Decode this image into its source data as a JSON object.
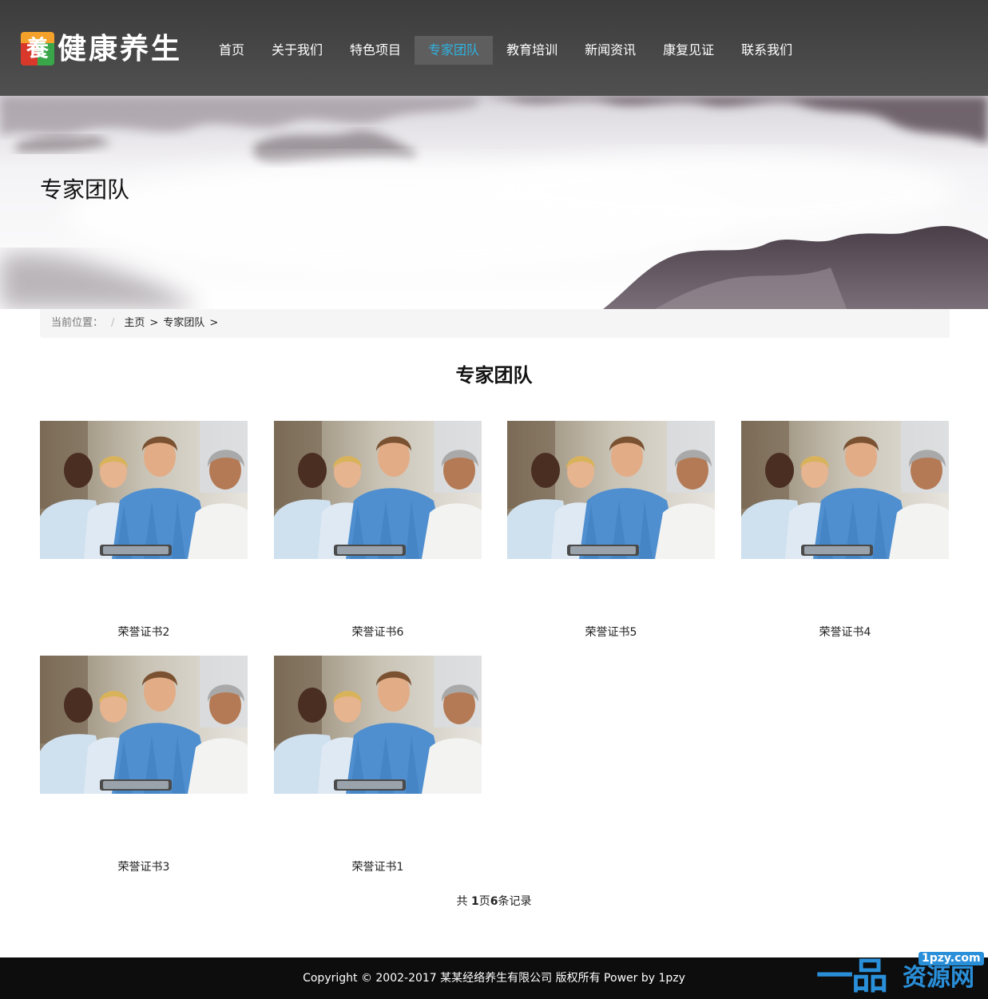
{
  "brand": {
    "logo_glyph": "養",
    "name": "健康养生"
  },
  "nav": {
    "items": [
      {
        "label": "首页"
      },
      {
        "label": "关于我们"
      },
      {
        "label": "特色项目"
      },
      {
        "label": "专家团队"
      },
      {
        "label": "教育培训"
      },
      {
        "label": "新闻资讯"
      },
      {
        "label": "康复见证"
      },
      {
        "label": "联系我们"
      }
    ],
    "active_index": 3,
    "active_color": "#2fb2e0"
  },
  "banner": {
    "title": "专家团队"
  },
  "breadcrumb": {
    "label": "当前位置：",
    "separator": "/",
    "items": [
      {
        "label": "主页"
      },
      {
        "label": "专家团队"
      }
    ],
    "arrow": ">"
  },
  "section": {
    "title": "专家团队"
  },
  "cards": [
    {
      "caption": "荣誉证书2"
    },
    {
      "caption": "荣誉证书6"
    },
    {
      "caption": "荣誉证书5"
    },
    {
      "caption": "荣誉证书4"
    },
    {
      "caption": "荣誉证书3"
    },
    {
      "caption": "荣誉证书1"
    }
  ],
  "pager": {
    "prefix": "共",
    "pages": "1",
    "pages_unit": "页",
    "records": "6",
    "records_unit": "条记录"
  },
  "footer": {
    "copyright": "Copyright © 2002-2017 某某经络养生有限公司 版权所有 Power by 1pzy"
  },
  "watermark": {
    "logo": "一品",
    "text": "资源网",
    "url": "1pzy.com"
  }
}
